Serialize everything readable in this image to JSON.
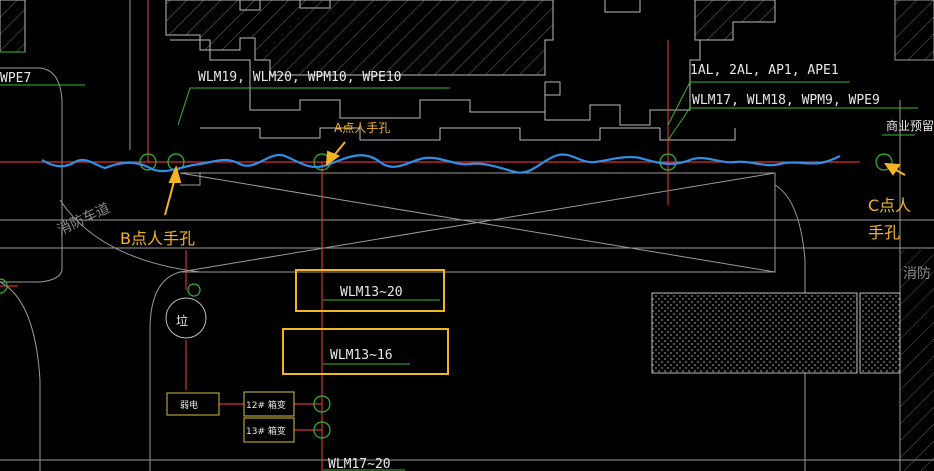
{
  "labels": {
    "top_left_partial": "WPE7",
    "cable_group_left": "WLM19, WLM20, WPM10, WPE10",
    "cable_group_right_1": "1AL, 2AL, AP1, APE1",
    "cable_group_right_2": "WLM17, WLM18, WPM9, WPE9",
    "commercial_reserve": "商业预留",
    "fire_road_left": "消防车道",
    "fire_road_right_partial": "消防",
    "garbage_symbol": "垃",
    "box_label_1": "WLM13~20",
    "box_label_2": "WLM13~16",
    "bottom_label": "WLM17~20",
    "transformer_small": "弱电",
    "transformer_12": "12# 箱变",
    "transformer_13": "13# 箱变"
  },
  "annotations": {
    "point_a": "A点人手孔",
    "point_b": "B点人手孔",
    "point_c_line1": "C点人",
    "point_c_line2": "手孔"
  },
  "colors": {
    "background": "#000000",
    "annotation": "#f5b521",
    "wave": "#2f8fe6",
    "cable_red": "#d83030",
    "leader_green": "#33b833",
    "line_gray": "#9a9a9a"
  }
}
